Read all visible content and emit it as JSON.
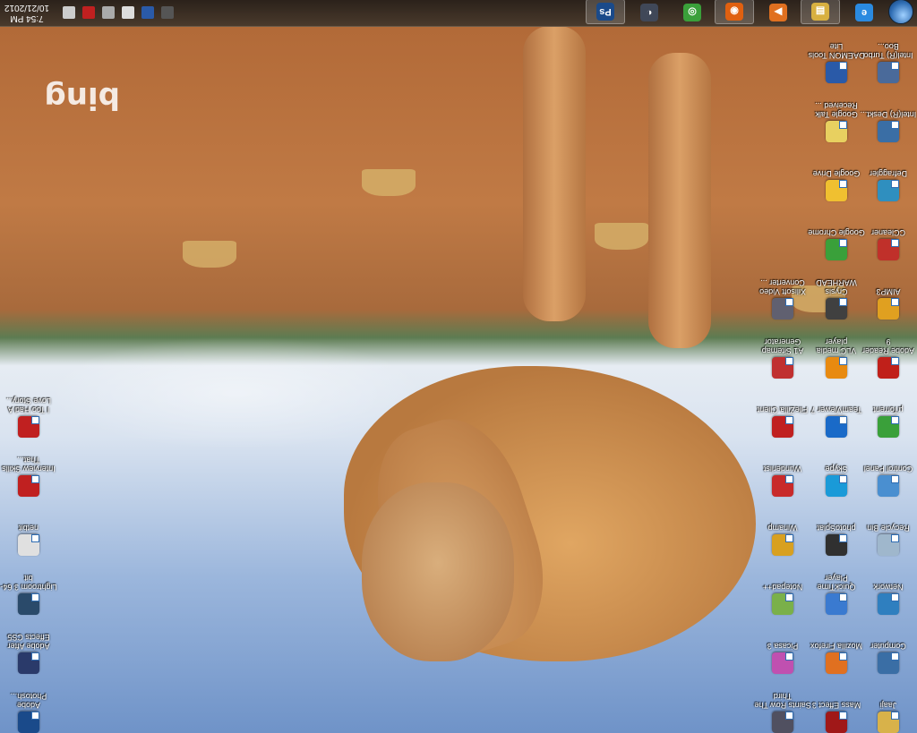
{
  "desktop": {
    "wallpaper_brand": "bing",
    "col1": [
      {
        "name": "Jaaji",
        "color": "#d8b24a"
      },
      {
        "name": "Computer",
        "color": "#3a6ea5"
      },
      {
        "name": "Network",
        "color": "#2f7fbf"
      },
      {
        "name": "Recycle Bin",
        "color": "#9fb7cc"
      },
      {
        "name": "Control Panel",
        "color": "#4a8fd0"
      },
      {
        "name": "µTorrent",
        "color": "#3aa03a"
      },
      {
        "name": "Adobe Reader 9",
        "color": "#c0201a"
      },
      {
        "name": "AIMP3",
        "color": "#e0a020"
      },
      {
        "name": "CCleaner",
        "color": "#c0302a"
      },
      {
        "name": "Defraggler",
        "color": "#2f8fbf"
      },
      {
        "name": "Intel(R) Deskt...",
        "color": "#3a6ea5"
      },
      {
        "name": "Intel(R) Turbo Boo...",
        "color": "#4a6a9a"
      }
    ],
    "col2": [
      {
        "name": "Mass Effect 3",
        "color": "#a01818"
      },
      {
        "name": "Mozilla Firefox",
        "color": "#e07020"
      },
      {
        "name": "QuickTime Player",
        "color": "#3a7ad0"
      },
      {
        "name": "photoSplat",
        "color": "#303030"
      },
      {
        "name": "Skype",
        "color": "#1a9ad8"
      },
      {
        "name": "TeamViewer 7",
        "color": "#1a6ac8"
      },
      {
        "name": "VLC media player",
        "color": "#e88a10"
      },
      {
        "name": "Crysis WARHEAD",
        "color": "#404040"
      },
      {
        "name": "Google Chrome",
        "color": "#3aa03a"
      },
      {
        "name": "Google Drive",
        "color": "#f0c030"
      },
      {
        "name": "Google Talk Received ...",
        "color": "#e8d060"
      },
      {
        "name": "DAEMON Tools Lite",
        "color": "#2a5aa8"
      }
    ],
    "col3": [
      {
        "name": "Saints Row The Third",
        "color": "#505060"
      },
      {
        "name": "Picasa 3",
        "color": "#c050b0"
      },
      {
        "name": "Notepad++",
        "color": "#7ab04a"
      },
      {
        "name": "Winamp",
        "color": "#d8a020"
      },
      {
        "name": "Wunderlist",
        "color": "#c82a2a"
      },
      {
        "name": "FileZilla Client",
        "color": "#c02020"
      },
      {
        "name": "A1 Sitemap Generator",
        "color": "#c03030"
      },
      {
        "name": "Xilisoft Video Converter ...",
        "color": "#606070"
      }
    ],
    "left_col": [
      {
        "name": "Adobe Photosh...",
        "color": "#1a4a8a"
      },
      {
        "name": "Adobe After Effects CS5",
        "color": "#2a3a6a"
      },
      {
        "name": "Lightroom 3 64-bit",
        "color": "#2a4a6a"
      },
      {
        "name": "netbit",
        "color": "#e0e0e0"
      },
      {
        "name": "Interview Skills That...",
        "color": "#c02020"
      },
      {
        "name": "I Too Had A Love Story...",
        "color": "#c02020"
      }
    ]
  },
  "taskbar": {
    "apps": [
      {
        "name": "Internet Explorer",
        "glyph": "e",
        "color": "#2a8ae0"
      },
      {
        "name": "Windows Explorer",
        "glyph": "▤",
        "color": "#d8b040"
      },
      {
        "name": "Windows Media Player",
        "glyph": "▶",
        "color": "#e07020"
      },
      {
        "name": "Firefox",
        "glyph": "◉",
        "color": "#e06010"
      },
      {
        "name": "Chrome",
        "glyph": "◎",
        "color": "#3aa03a"
      },
      {
        "name": "Steam",
        "glyph": "◐",
        "color": "#404858"
      },
      {
        "name": "Photoshop",
        "glyph": "Ps",
        "color": "#1a4a8a"
      }
    ],
    "clock_time": "7:54 PM",
    "clock_date": "10/21/2012"
  }
}
